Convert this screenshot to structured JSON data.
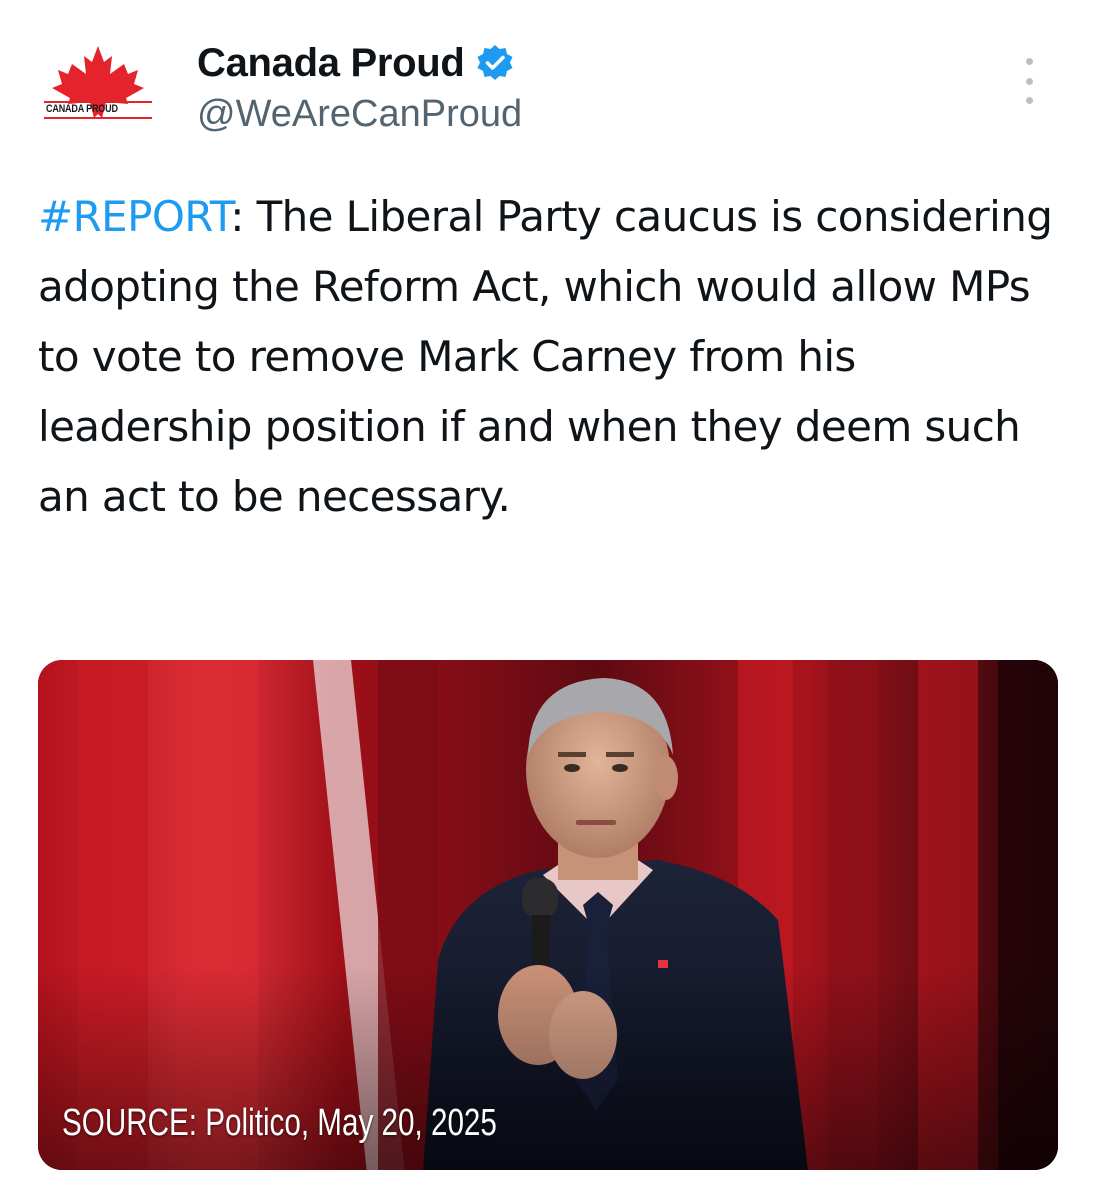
{
  "post": {
    "author": {
      "display_name": "Canada Proud",
      "handle": "@WeAreCanProud",
      "avatar_label": "CANADA PROUD",
      "avatar_icon": "maple-leaf-icon",
      "verified_icon": "verified-badge-icon"
    },
    "text": {
      "hashtag": "#REPORT",
      "body": ": The Liberal Party caucus is considering adopting the Reform Act, which would allow MPs to vote to remove Mark Carney from his leadership position if and when they deem such an act to be necessary."
    },
    "media": {
      "caption": "SOURCE: Politico, May 20, 2025"
    },
    "more_icon": "more-options-icon"
  },
  "colors": {
    "link": "#1d9bf0",
    "text": "#0f1419",
    "secondary_text": "#536471",
    "brand_red": "#e5232c"
  }
}
